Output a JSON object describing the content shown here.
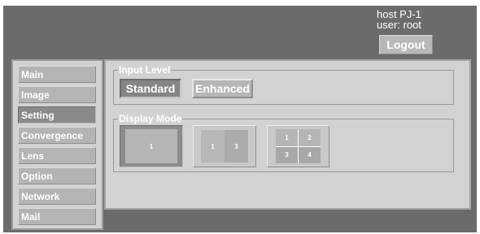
{
  "header": {
    "host_line": "host PJ-1",
    "user_line": "user: root",
    "logout_label": "Logout"
  },
  "sidebar": {
    "items": [
      {
        "label": "Main",
        "active": false
      },
      {
        "label": "Image",
        "active": false
      },
      {
        "label": "Setting",
        "active": true
      },
      {
        "label": "Convergence",
        "active": false
      },
      {
        "label": "Lens",
        "active": false
      },
      {
        "label": "Option",
        "active": false
      },
      {
        "label": "Network",
        "active": false
      },
      {
        "label": "Mail",
        "active": false
      }
    ]
  },
  "input_level": {
    "legend": "Input Level",
    "options": [
      "Standard",
      "Enhanced"
    ],
    "selected": "Standard"
  },
  "display_mode": {
    "legend": "Display Mode",
    "single": [
      "1"
    ],
    "dual": [
      "1",
      "3"
    ],
    "quad": [
      "1",
      "2",
      "3",
      "4"
    ],
    "selected": "single"
  },
  "colors": {
    "frame": "#6b6b6b",
    "panel": "#d2d2d2",
    "button": "#b6b6b6",
    "button_active": "#858585",
    "text": "#ffffff"
  }
}
